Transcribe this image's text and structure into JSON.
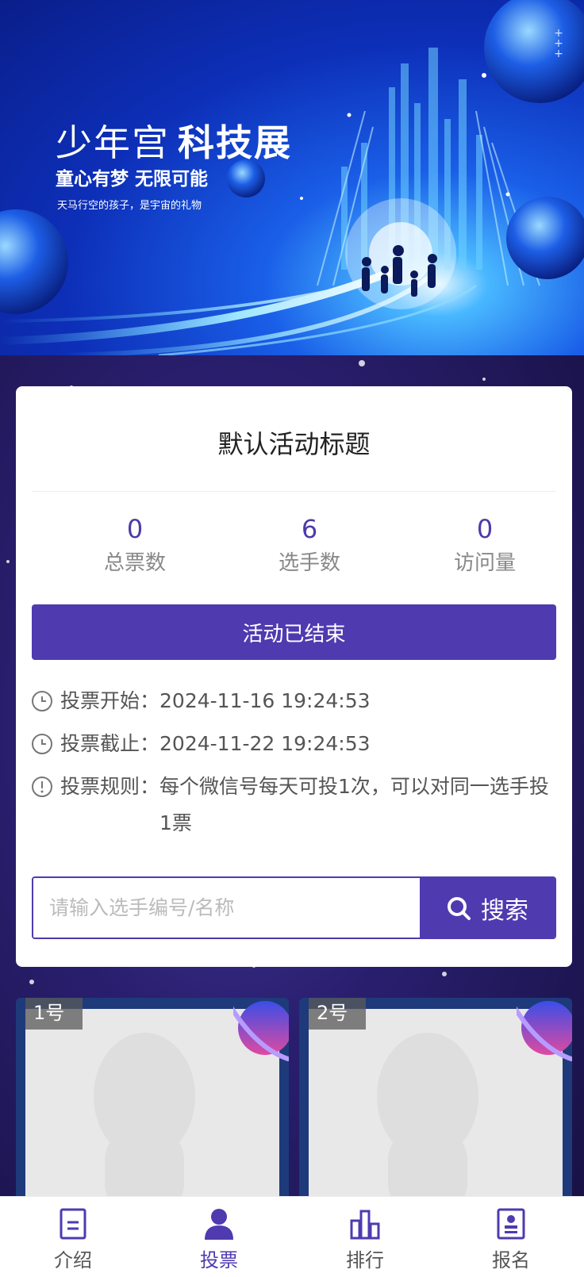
{
  "banner": {
    "title_light": "少年宫",
    "title_bold": "科技展",
    "subtitle": "童心有梦 无限可能",
    "tagline": "天马行空的孩子，是宇宙的礼物"
  },
  "activity": {
    "title": "默认活动标题",
    "stats": [
      {
        "value": "0",
        "label": "总票数"
      },
      {
        "value": "6",
        "label": "选手数"
      },
      {
        "value": "0",
        "label": "访问量"
      }
    ],
    "status_button": "活动已结束",
    "vote_start_label": "投票开始：",
    "vote_start": "2024-11-16 19:24:53",
    "vote_end_label": "投票截止：",
    "vote_end": "2024-11-22 19:24:53",
    "rules_label": "投票规则：",
    "rules": "每个微信号每天可投1次，可以对同一选手投1票"
  },
  "search": {
    "placeholder": "请输入选手编号/名称",
    "button": "搜索"
  },
  "players": [
    {
      "badge": "1号"
    },
    {
      "badge": "2号"
    }
  ],
  "tabbar": [
    {
      "label": "介绍",
      "icon": "document-icon"
    },
    {
      "label": "投票",
      "icon": "user-icon"
    },
    {
      "label": "排行",
      "icon": "chart-icon"
    },
    {
      "label": "报名",
      "icon": "badge-icon"
    }
  ],
  "colors": {
    "accent": "#4f3ab0",
    "banner_blue": "#1a5fe8"
  }
}
